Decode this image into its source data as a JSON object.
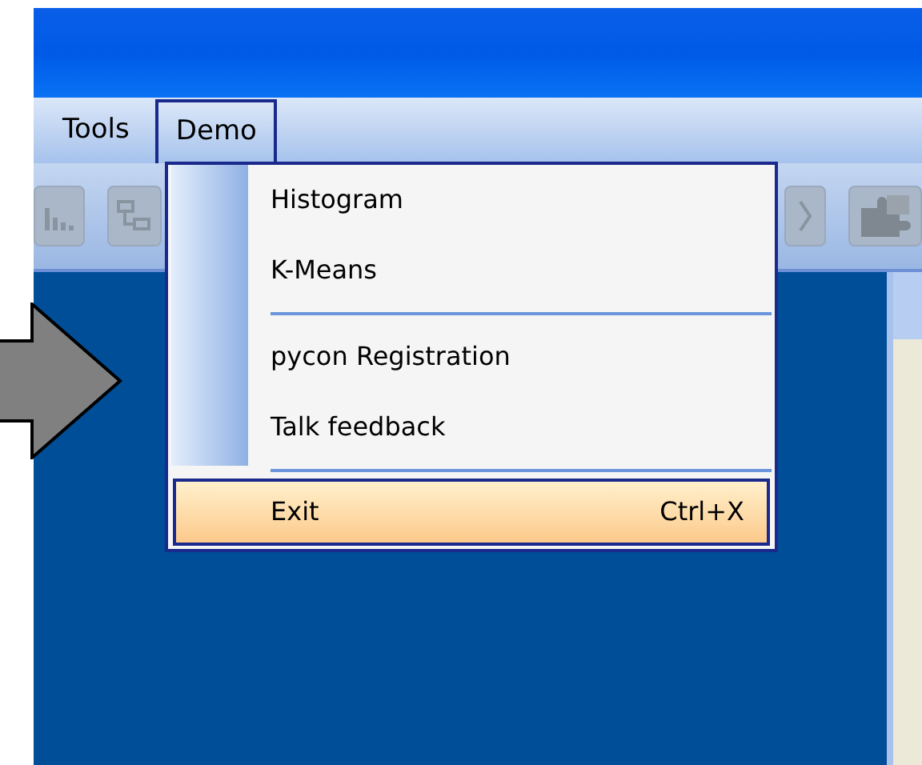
{
  "menu_bar": [
    {
      "label": "Tools",
      "selected": false
    },
    {
      "label": "Demo",
      "selected": true
    }
  ],
  "menu": [
    {
      "kind": "item",
      "label": "Histogram",
      "selected": false
    },
    {
      "kind": "item",
      "label": "K-Means",
      "selected": false
    },
    {
      "kind": "separator"
    },
    {
      "kind": "item",
      "label": "pycon Registration",
      "selected": false
    },
    {
      "kind": "item",
      "label": "Talk feedback",
      "selected": false
    },
    {
      "kind": "separator"
    },
    {
      "kind": "item",
      "label": "Exit",
      "shortcut": "Ctrl+X",
      "selected": true
    }
  ]
}
